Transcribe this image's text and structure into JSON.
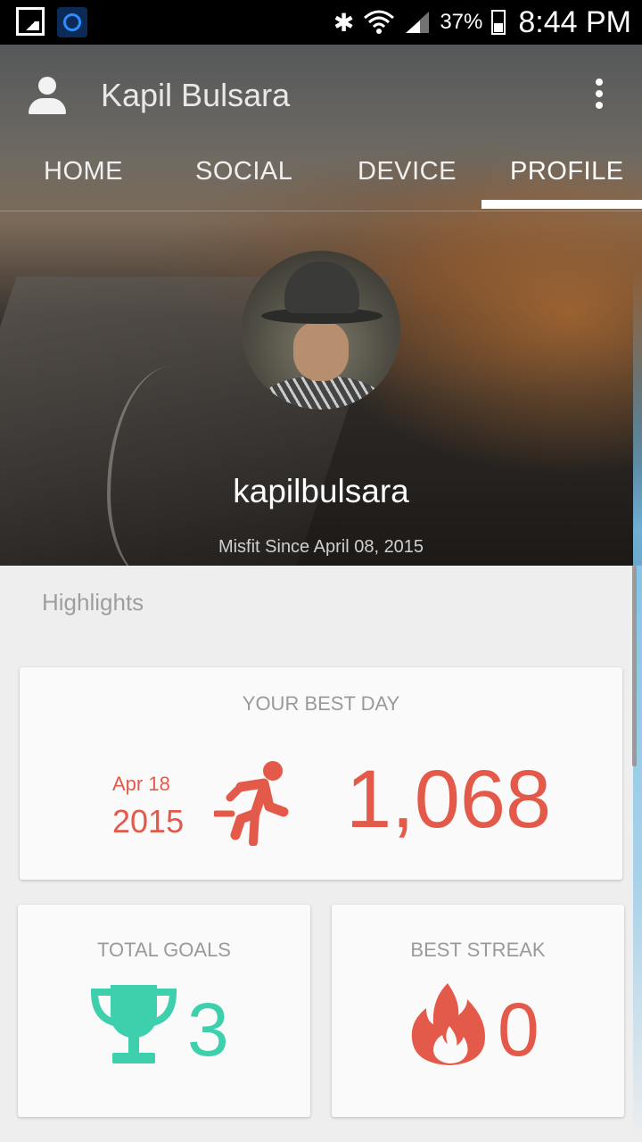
{
  "status_bar": {
    "battery": "37%",
    "time": "8:44 PM",
    "icons": [
      "image-icon",
      "app-icon",
      "bluetooth-icon",
      "wifi-icon",
      "signal-icon",
      "battery-icon"
    ]
  },
  "app_bar": {
    "title": "Kapil Bulsara",
    "icons": [
      "user-icon",
      "overflow-menu-icon"
    ]
  },
  "tabs": [
    {
      "label": "HOME",
      "selected": false
    },
    {
      "label": "SOCIAL",
      "selected": false
    },
    {
      "label": "DEVICE",
      "selected": false
    },
    {
      "label": "PROFILE",
      "selected": true
    }
  ],
  "profile": {
    "username": "kapilbulsara",
    "member_since": "Misfit Since April 08, 2015"
  },
  "highlights": {
    "section_title": "Highlights",
    "best_day": {
      "title": "YOUR BEST DAY",
      "date": "Apr 18",
      "year": "2015",
      "value": "1,068",
      "icon": "running-person-icon"
    },
    "total_goals": {
      "title": "TOTAL GOALS",
      "value": "3",
      "icon": "trophy-icon"
    },
    "best_streak": {
      "title": "BEST STREAK",
      "value": "0",
      "icon": "flame-icon"
    }
  },
  "colors": {
    "accent_red": "#e45a4a",
    "accent_teal": "#3ecfad",
    "background": "#eeeeee"
  }
}
